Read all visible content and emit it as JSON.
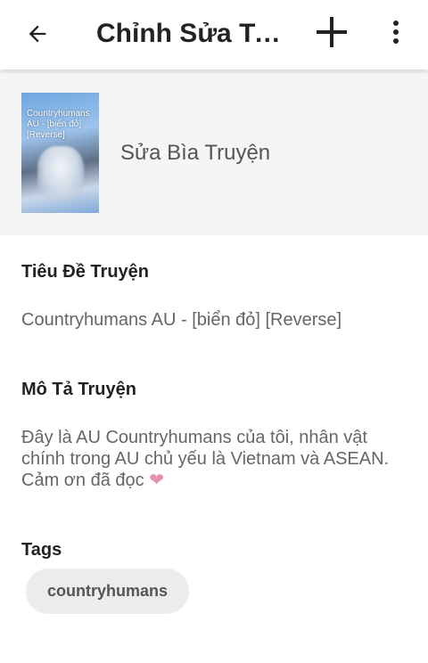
{
  "appbar": {
    "title": "Chỉnh Sửa Truyện",
    "back_icon": "arrow-left-icon",
    "add_icon": "plus-icon",
    "more_icon": "more-vertical-icon"
  },
  "cover": {
    "image_text": "Countryhumans AU - [biển đỏ] [Reverse]",
    "edit_label": "Sửa Bìa Truyện"
  },
  "story": {
    "title_label": "Tiêu Đề Truyện",
    "title_value": "Countryhumans AU - [biển đỏ] [Reverse]",
    "description_label": "Mô Tả Truyện",
    "description_value": "Đây là AU Countryhumans của tôi, nhân vật chính trong AU chủ yếu là Vietnam và ASEAN. Cảm ơn đã đọc",
    "description_emoji": "❤"
  },
  "tags": {
    "label": "Tags",
    "items": [
      "countryhumans"
    ]
  },
  "colors": {
    "background": "#ffffff",
    "cover_section_bg": "#f5f5f5",
    "chip_bg": "#ececec",
    "heart": "#e58fb3"
  }
}
